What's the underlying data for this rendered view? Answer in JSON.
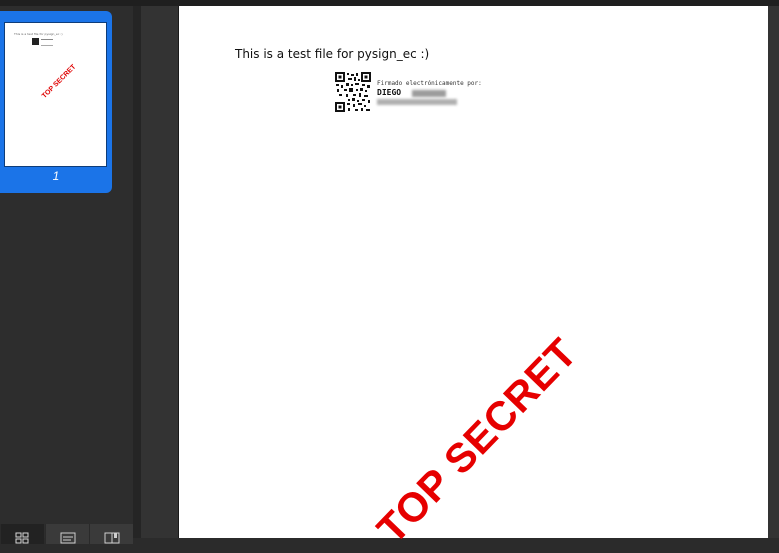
{
  "document": {
    "text": "This is a test file for pysign_ec :)",
    "signature": {
      "heading": "Firmado electrónicamente por:",
      "name": "DIEGO"
    },
    "stamp": "TOP SECRET",
    "stamp_color": "#e60000"
  },
  "sidebar": {
    "selected_page_number": "1",
    "accent_color": "#1b74e8",
    "view_tabs": [
      {
        "icon": "grid-icon"
      },
      {
        "icon": "outline-icon"
      },
      {
        "icon": "bookmark-icon"
      }
    ]
  }
}
